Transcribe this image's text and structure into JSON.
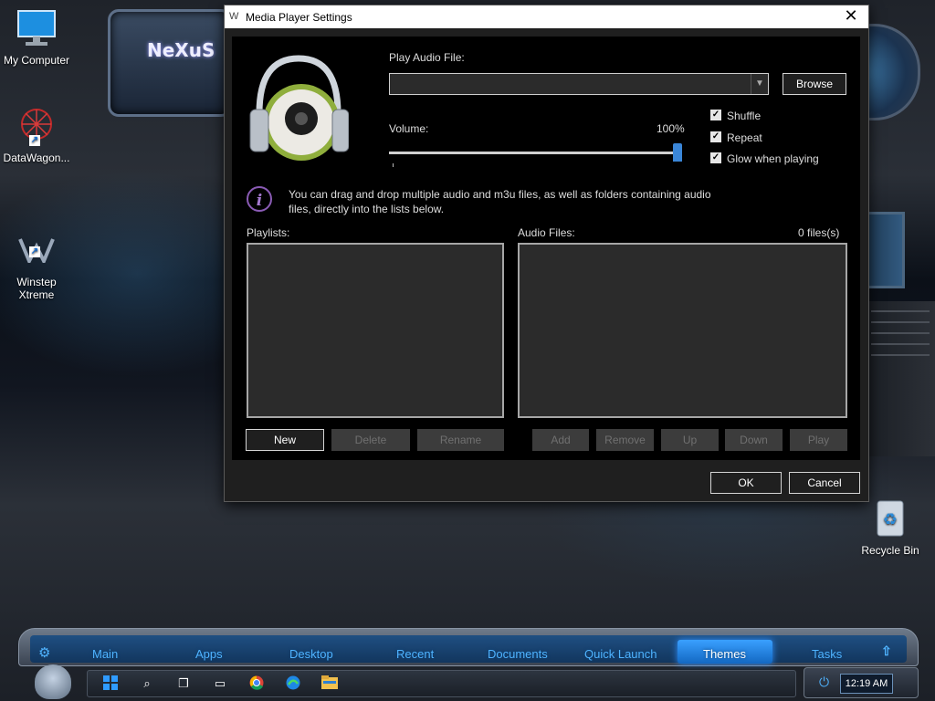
{
  "desktop": {
    "icons": [
      {
        "label": "My Computer"
      },
      {
        "label": "DataWagon..."
      },
      {
        "label": "Winstep\nXtreme"
      },
      {
        "label": "Recycle Bin"
      }
    ],
    "widget_logo": "NeXuS"
  },
  "dialog": {
    "title": "Media Player Settings",
    "play_audio_label": "Play Audio File:",
    "play_audio_value": "",
    "browse_label": "Browse",
    "volume_label": "Volume:",
    "volume_value_text": "100%",
    "volume_level": 1.0,
    "checkboxes": [
      {
        "label": "Shuffle",
        "checked": true
      },
      {
        "label": "Repeat",
        "checked": true
      },
      {
        "label": "Glow when playing",
        "checked": true
      }
    ],
    "info_text": "You can drag and drop multiple audio and m3u files, as well as folders containing audio files, directly into the lists below.",
    "playlists_label": "Playlists:",
    "audio_files_label": "Audio Files:",
    "files_count": "0 files(s)",
    "playlist_buttons": [
      {
        "label": "New",
        "enabled": true
      },
      {
        "label": "Delete",
        "enabled": false
      },
      {
        "label": "Rename",
        "enabled": false
      }
    ],
    "audio_buttons": [
      {
        "label": "Add",
        "enabled": false
      },
      {
        "label": "Remove",
        "enabled": false
      },
      {
        "label": "Up",
        "enabled": false
      },
      {
        "label": "Down",
        "enabled": false
      },
      {
        "label": "Play",
        "enabled": false
      }
    ],
    "ok_label": "OK",
    "cancel_label": "Cancel"
  },
  "dock": {
    "tabs": [
      "Main",
      "Apps",
      "Desktop",
      "Recent",
      "Documents",
      "Quick Launch",
      "Themes",
      "Tasks"
    ],
    "active_tab": "Themes"
  },
  "taskbar": {
    "clock": "12:19 AM"
  },
  "colors": {
    "accent": "#3a86d8",
    "dock_text": "#4fb3ff",
    "info_icon": "#a579d0"
  }
}
